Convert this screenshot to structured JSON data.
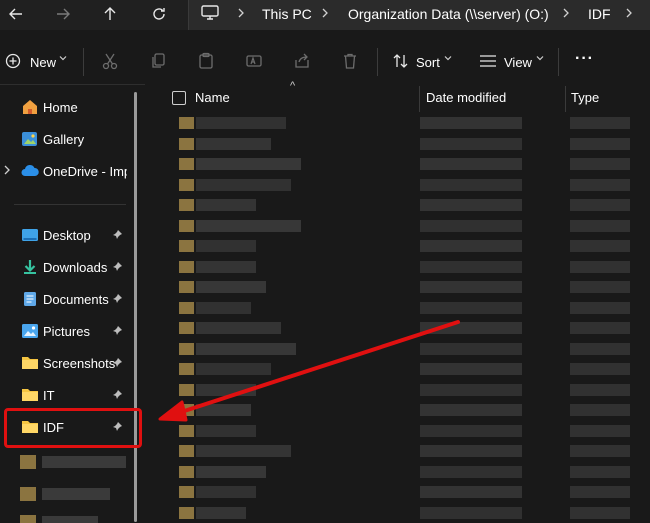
{
  "nav": {
    "back_icon": "arrow-left-icon",
    "forward_icon": "arrow-right-icon",
    "up_icon": "arrow-up-icon",
    "refresh_icon": "refresh-icon"
  },
  "breadcrumb": {
    "items": [
      "This PC",
      "Organization Data (\\\\server) (O:)",
      "IDF"
    ],
    "separator": ">"
  },
  "toolbar": {
    "new_label": "New",
    "sort_label": "Sort",
    "view_label": "View",
    "more_label": "···"
  },
  "sidebar": {
    "items": [
      {
        "label": "Home"
      },
      {
        "label": "Gallery"
      },
      {
        "label": "OneDrive - Impa"
      },
      {
        "label": "Desktop"
      },
      {
        "label": "Downloads"
      },
      {
        "label": "Documents"
      },
      {
        "label": "Pictures"
      },
      {
        "label": "Screenshots"
      },
      {
        "label": "IT"
      },
      {
        "label": "IDF"
      }
    ],
    "pin_glyph": "📌",
    "expand_glyph": "›"
  },
  "columns": {
    "name": "Name",
    "date_modified": "Date modified",
    "type": "Type",
    "sort_indicator": "^"
  },
  "colors": {
    "background": "#191919",
    "annotation": "#e01010",
    "folder": "#f5c542"
  }
}
